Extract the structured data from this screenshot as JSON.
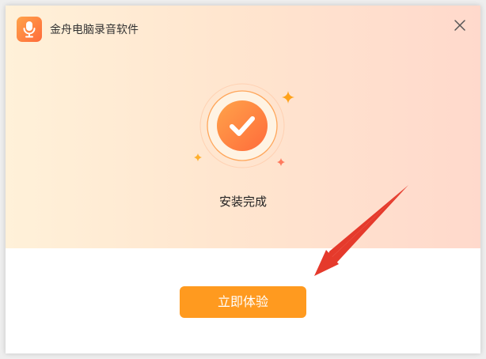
{
  "window": {
    "title": "金舟电脑录音软件",
    "app_icon": "microphone-icon",
    "close_icon": "close-icon"
  },
  "status": {
    "icon": "checkmark-icon",
    "message": "安装完成"
  },
  "actions": {
    "primary_label": "立即体验"
  },
  "annotation": {
    "icon": "red-arrow-icon"
  },
  "colors": {
    "accent": "#ff9a1f",
    "badge_gradient_start": "#ffa34a",
    "badge_gradient_end": "#ff6b3b",
    "arrow": "#e53a2c"
  }
}
